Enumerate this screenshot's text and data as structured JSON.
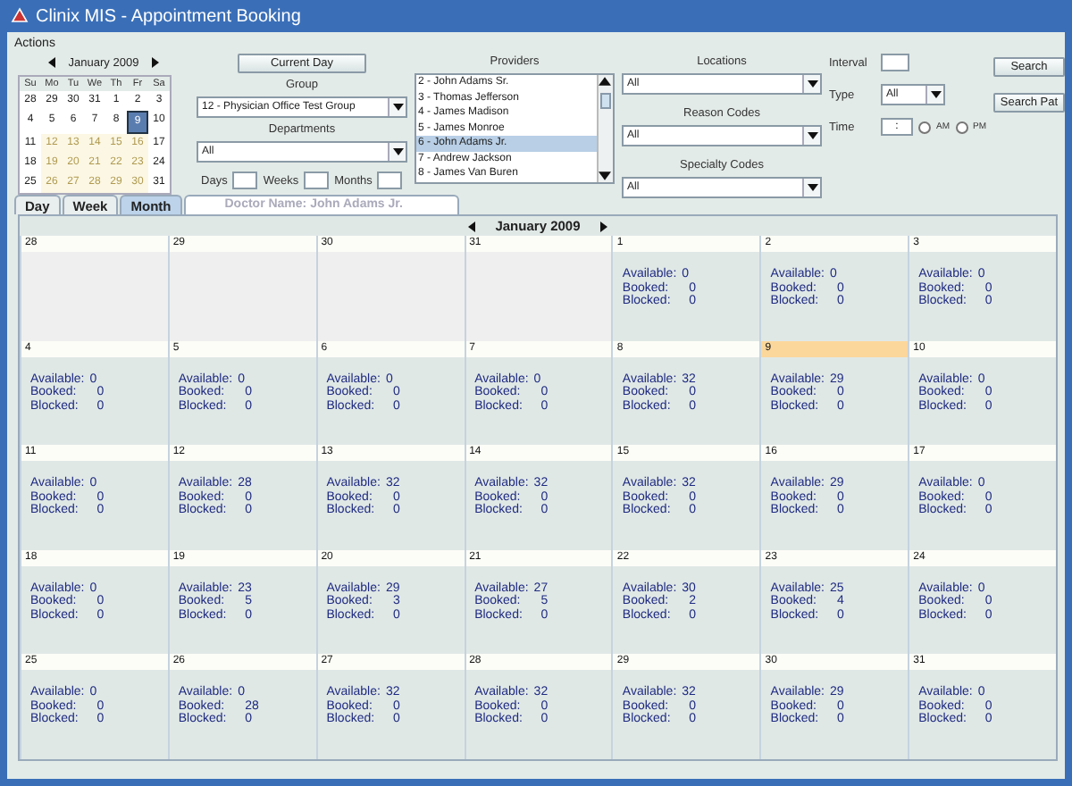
{
  "window": {
    "title": "Clinix MIS - Appointment Booking"
  },
  "menu": [
    "Actions"
  ],
  "mini_calendar": {
    "title": "January 2009",
    "weekdays": [
      "Su",
      "Mo",
      "Tu",
      "We",
      "Th",
      "Fr",
      "Sa"
    ],
    "days": [
      {
        "label": "28",
        "highlighted": false,
        "selected": false
      },
      {
        "label": "29",
        "highlighted": false,
        "selected": false
      },
      {
        "label": "30",
        "highlighted": false,
        "selected": false
      },
      {
        "label": "31",
        "highlighted": false,
        "selected": false
      },
      {
        "label": "1",
        "highlighted": false,
        "selected": false
      },
      {
        "label": "2",
        "highlighted": false,
        "selected": false
      },
      {
        "label": "3",
        "highlighted": false,
        "selected": false
      },
      {
        "label": "4",
        "highlighted": false,
        "selected": false
      },
      {
        "label": "5",
        "highlighted": false,
        "selected": false
      },
      {
        "label": "6",
        "highlighted": false,
        "selected": false
      },
      {
        "label": "7",
        "highlighted": false,
        "selected": false
      },
      {
        "label": "8",
        "highlighted": false,
        "selected": false
      },
      {
        "label": "9",
        "highlighted": false,
        "selected": true
      },
      {
        "label": "10",
        "highlighted": false,
        "selected": false
      },
      {
        "label": "11",
        "highlighted": false,
        "selected": false
      },
      {
        "label": "12",
        "highlighted": true,
        "selected": false
      },
      {
        "label": "13",
        "highlighted": true,
        "selected": false
      },
      {
        "label": "14",
        "highlighted": true,
        "selected": false
      },
      {
        "label": "15",
        "highlighted": true,
        "selected": false
      },
      {
        "label": "16",
        "highlighted": true,
        "selected": false
      },
      {
        "label": "17",
        "highlighted": false,
        "selected": false
      },
      {
        "label": "18",
        "highlighted": false,
        "selected": false
      },
      {
        "label": "19",
        "highlighted": true,
        "selected": false
      },
      {
        "label": "20",
        "highlighted": true,
        "selected": false
      },
      {
        "label": "21",
        "highlighted": true,
        "selected": false
      },
      {
        "label": "22",
        "highlighted": true,
        "selected": false
      },
      {
        "label": "23",
        "highlighted": true,
        "selected": false
      },
      {
        "label": "24",
        "highlighted": false,
        "selected": false
      },
      {
        "label": "25",
        "highlighted": false,
        "selected": false
      },
      {
        "label": "26",
        "highlighted": true,
        "selected": false
      },
      {
        "label": "27",
        "highlighted": true,
        "selected": false
      },
      {
        "label": "28",
        "highlighted": true,
        "selected": false
      },
      {
        "label": "29",
        "highlighted": true,
        "selected": false
      },
      {
        "label": "30",
        "highlighted": true,
        "selected": false
      },
      {
        "label": "31",
        "highlighted": false,
        "selected": false
      }
    ]
  },
  "filters": {
    "current_day_button": "Current Day",
    "group": {
      "label": "Group",
      "value": "12 - Physician Office Test Group"
    },
    "departments": {
      "label": "Departments",
      "value": "All"
    },
    "periods": [
      {
        "label": "Days"
      },
      {
        "label": "Weeks"
      },
      {
        "label": "Months"
      }
    ],
    "providers": {
      "label": "Providers",
      "items": [
        {
          "label": "2 - John Adams Sr.",
          "selected": false
        },
        {
          "label": "3 - Thomas Jefferson",
          "selected": false
        },
        {
          "label": "4 - James Madison",
          "selected": false
        },
        {
          "label": "5 - James Monroe",
          "selected": false
        },
        {
          "label": "6 - John Adams Jr.",
          "selected": true
        },
        {
          "label": "7 - Andrew Jackson",
          "selected": false
        },
        {
          "label": "8 - James Van Buren",
          "selected": false
        }
      ]
    },
    "locations": {
      "label": "Locations",
      "value": "All"
    },
    "reason_codes": {
      "label": "Reason Codes",
      "value": "All"
    },
    "specialty_codes": {
      "label": "Specialty Codes",
      "value": "All"
    },
    "interval": {
      "label": "Interval"
    },
    "type": {
      "label": "Type",
      "value": "All"
    },
    "time": {
      "label": "Time",
      "value": ":",
      "options": [
        {
          "label": "AM",
          "selected": false
        },
        {
          "label": "PM",
          "selected": false
        }
      ]
    },
    "buttons": [
      "Search",
      "Search Pat"
    ]
  },
  "tabs": [
    {
      "label": "Day",
      "selected": false
    },
    {
      "label": "Week",
      "selected": false
    },
    {
      "label": "Month",
      "selected": true
    }
  ],
  "doctor_name": "Doctor Name:  John Adams Jr.",
  "month_view": {
    "title": "January 2009",
    "days": [
      {
        "day": "28",
        "in_month": false,
        "today": false
      },
      {
        "day": "29",
        "in_month": false,
        "today": false
      },
      {
        "day": "30",
        "in_month": false,
        "today": false
      },
      {
        "day": "31",
        "in_month": false,
        "today": false
      },
      {
        "day": "1",
        "in_month": true,
        "today": false,
        "stats": [
          {
            "label": "Available:",
            "value": "0"
          },
          {
            "label": "Booked:",
            "value": "0"
          },
          {
            "label": "Blocked:",
            "value": "0"
          }
        ]
      },
      {
        "day": "2",
        "in_month": true,
        "today": false,
        "stats": [
          {
            "label": "Available:",
            "value": "0"
          },
          {
            "label": "Booked:",
            "value": "0"
          },
          {
            "label": "Blocked:",
            "value": "0"
          }
        ]
      },
      {
        "day": "3",
        "in_month": true,
        "today": false,
        "stats": [
          {
            "label": "Available:",
            "value": "0"
          },
          {
            "label": "Booked:",
            "value": "0"
          },
          {
            "label": "Blocked:",
            "value": "0"
          }
        ]
      },
      {
        "day": "4",
        "in_month": true,
        "today": false,
        "stats": [
          {
            "label": "Available:",
            "value": "0"
          },
          {
            "label": "Booked:",
            "value": "0"
          },
          {
            "label": "Blocked:",
            "value": "0"
          }
        ]
      },
      {
        "day": "5",
        "in_month": true,
        "today": false,
        "stats": [
          {
            "label": "Available:",
            "value": "0"
          },
          {
            "label": "Booked:",
            "value": "0"
          },
          {
            "label": "Blocked:",
            "value": "0"
          }
        ]
      },
      {
        "day": "6",
        "in_month": true,
        "today": false,
        "stats": [
          {
            "label": "Available:",
            "value": "0"
          },
          {
            "label": "Booked:",
            "value": "0"
          },
          {
            "label": "Blocked:",
            "value": "0"
          }
        ]
      },
      {
        "day": "7",
        "in_month": true,
        "today": false,
        "stats": [
          {
            "label": "Available:",
            "value": "0"
          },
          {
            "label": "Booked:",
            "value": "0"
          },
          {
            "label": "Blocked:",
            "value": "0"
          }
        ]
      },
      {
        "day": "8",
        "in_month": true,
        "today": false,
        "stats": [
          {
            "label": "Available:",
            "value": "32"
          },
          {
            "label": "Booked:",
            "value": "0"
          },
          {
            "label": "Blocked:",
            "value": "0"
          }
        ]
      },
      {
        "day": "9",
        "in_month": true,
        "today": true,
        "stats": [
          {
            "label": "Available:",
            "value": "29"
          },
          {
            "label": "Booked:",
            "value": "0"
          },
          {
            "label": "Blocked:",
            "value": "0"
          }
        ]
      },
      {
        "day": "10",
        "in_month": true,
        "today": false,
        "stats": [
          {
            "label": "Available:",
            "value": "0"
          },
          {
            "label": "Booked:",
            "value": "0"
          },
          {
            "label": "Blocked:",
            "value": "0"
          }
        ]
      },
      {
        "day": "11",
        "in_month": true,
        "today": false,
        "stats": [
          {
            "label": "Available:",
            "value": "0"
          },
          {
            "label": "Booked:",
            "value": "0"
          },
          {
            "label": "Blocked:",
            "value": "0"
          }
        ]
      },
      {
        "day": "12",
        "in_month": true,
        "today": false,
        "stats": [
          {
            "label": "Available:",
            "value": "28"
          },
          {
            "label": "Booked:",
            "value": "0"
          },
          {
            "label": "Blocked:",
            "value": "0"
          }
        ]
      },
      {
        "day": "13",
        "in_month": true,
        "today": false,
        "stats": [
          {
            "label": "Available:",
            "value": "32"
          },
          {
            "label": "Booked:",
            "value": "0"
          },
          {
            "label": "Blocked:",
            "value": "0"
          }
        ]
      },
      {
        "day": "14",
        "in_month": true,
        "today": false,
        "stats": [
          {
            "label": "Available:",
            "value": "32"
          },
          {
            "label": "Booked:",
            "value": "0"
          },
          {
            "label": "Blocked:",
            "value": "0"
          }
        ]
      },
      {
        "day": "15",
        "in_month": true,
        "today": false,
        "stats": [
          {
            "label": "Available:",
            "value": "32"
          },
          {
            "label": "Booked:",
            "value": "0"
          },
          {
            "label": "Blocked:",
            "value": "0"
          }
        ]
      },
      {
        "day": "16",
        "in_month": true,
        "today": false,
        "stats": [
          {
            "label": "Available:",
            "value": "29"
          },
          {
            "label": "Booked:",
            "value": "0"
          },
          {
            "label": "Blocked:",
            "value": "0"
          }
        ]
      },
      {
        "day": "17",
        "in_month": true,
        "today": false,
        "stats": [
          {
            "label": "Available:",
            "value": "0"
          },
          {
            "label": "Booked:",
            "value": "0"
          },
          {
            "label": "Blocked:",
            "value": "0"
          }
        ]
      },
      {
        "day": "18",
        "in_month": true,
        "today": false,
        "stats": [
          {
            "label": "Available:",
            "value": "0"
          },
          {
            "label": "Booked:",
            "value": "0"
          },
          {
            "label": "Blocked:",
            "value": "0"
          }
        ]
      },
      {
        "day": "19",
        "in_month": true,
        "today": false,
        "stats": [
          {
            "label": "Available:",
            "value": "23"
          },
          {
            "label": "Booked:",
            "value": "5"
          },
          {
            "label": "Blocked:",
            "value": "0"
          }
        ]
      },
      {
        "day": "20",
        "in_month": true,
        "today": false,
        "stats": [
          {
            "label": "Available:",
            "value": "29"
          },
          {
            "label": "Booked:",
            "value": "3"
          },
          {
            "label": "Blocked:",
            "value": "0"
          }
        ]
      },
      {
        "day": "21",
        "in_month": true,
        "today": false,
        "stats": [
          {
            "label": "Available:",
            "value": "27"
          },
          {
            "label": "Booked:",
            "value": "5"
          },
          {
            "label": "Blocked:",
            "value": "0"
          }
        ]
      },
      {
        "day": "22",
        "in_month": true,
        "today": false,
        "stats": [
          {
            "label": "Available:",
            "value": "30"
          },
          {
            "label": "Booked:",
            "value": "2"
          },
          {
            "label": "Blocked:",
            "value": "0"
          }
        ]
      },
      {
        "day": "23",
        "in_month": true,
        "today": false,
        "stats": [
          {
            "label": "Available:",
            "value": "25"
          },
          {
            "label": "Booked:",
            "value": "4"
          },
          {
            "label": "Blocked:",
            "value": "0"
          }
        ]
      },
      {
        "day": "24",
        "in_month": true,
        "today": false,
        "stats": [
          {
            "label": "Available:",
            "value": "0"
          },
          {
            "label": "Booked:",
            "value": "0"
          },
          {
            "label": "Blocked:",
            "value": "0"
          }
        ]
      },
      {
        "day": "25",
        "in_month": true,
        "today": false,
        "stats": [
          {
            "label": "Available:",
            "value": "0"
          },
          {
            "label": "Booked:",
            "value": "0"
          },
          {
            "label": "Blocked:",
            "value": "0"
          }
        ]
      },
      {
        "day": "26",
        "in_month": true,
        "today": false,
        "stats": [
          {
            "label": "Available:",
            "value": "0"
          },
          {
            "label": "Booked:",
            "value": "28"
          },
          {
            "label": "Blocked:",
            "value": "0"
          }
        ]
      },
      {
        "day": "27",
        "in_month": true,
        "today": false,
        "stats": [
          {
            "label": "Available:",
            "value": "32"
          },
          {
            "label": "Booked:",
            "value": "0"
          },
          {
            "label": "Blocked:",
            "value": "0"
          }
        ]
      },
      {
        "day": "28",
        "in_month": true,
        "today": false,
        "stats": [
          {
            "label": "Available:",
            "value": "32"
          },
          {
            "label": "Booked:",
            "value": "0"
          },
          {
            "label": "Blocked:",
            "value": "0"
          }
        ]
      },
      {
        "day": "29",
        "in_month": true,
        "today": false,
        "stats": [
          {
            "label": "Available:",
            "value": "32"
          },
          {
            "label": "Booked:",
            "value": "0"
          },
          {
            "label": "Blocked:",
            "value": "0"
          }
        ]
      },
      {
        "day": "30",
        "in_month": true,
        "today": false,
        "stats": [
          {
            "label": "Available:",
            "value": "29"
          },
          {
            "label": "Booked:",
            "value": "0"
          },
          {
            "label": "Blocked:",
            "value": "0"
          }
        ]
      },
      {
        "day": "31",
        "in_month": true,
        "today": false,
        "stats": [
          {
            "label": "Available:",
            "value": "0"
          },
          {
            "label": "Booked:",
            "value": "0"
          },
          {
            "label": "Blocked:",
            "value": "0"
          }
        ]
      }
    ]
  }
}
